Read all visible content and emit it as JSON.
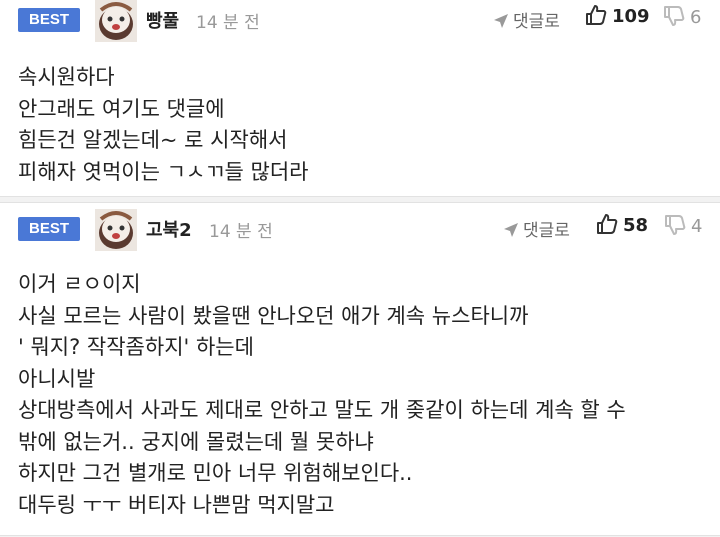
{
  "comments": [
    {
      "badge": "BEST",
      "author": "빵풀",
      "time": "14 분 전",
      "reply_label": "댓글로",
      "likes": "109",
      "dislikes": "6",
      "lines": [
        "속시원하다",
        "안그래도 여기도 댓글에",
        "힘든건 알겠는데~ 로 시작해서",
        "피해자 엿먹이는 ㄱㅅㄲ들 많더라"
      ]
    },
    {
      "badge": "BEST",
      "author": "고북2",
      "time": "14 분 전",
      "reply_label": "댓글로",
      "likes": "58",
      "dislikes": "4",
      "lines": [
        "이거 ㄹㅇ이지",
        "사실 모르는 사람이 봤을땐 안나오던 애가 계속 뉴스타니까",
        "' 뭐지? 작작좀하지' 하는데",
        "아니시발",
        "상대방측에서 사과도 제대로 안하고 말도 개 좆같이 하는데 계속 할 수",
        "밖에 없는거.. 궁지에 몰렸는데 뭘 못하냐",
        "하지만 그건 별개로 민아 너무 위험해보인다..",
        "대두링 ㅜㅜ 버티자 나쁜맘 먹지말고"
      ]
    }
  ],
  "colors": {
    "best_badge": "#4a78d6",
    "muted": "#999999"
  },
  "icons": {
    "reply": "send-arrow-icon",
    "like": "thumbs-up-icon",
    "dislike": "thumbs-down-icon",
    "avatar": "avatar-icon"
  }
}
